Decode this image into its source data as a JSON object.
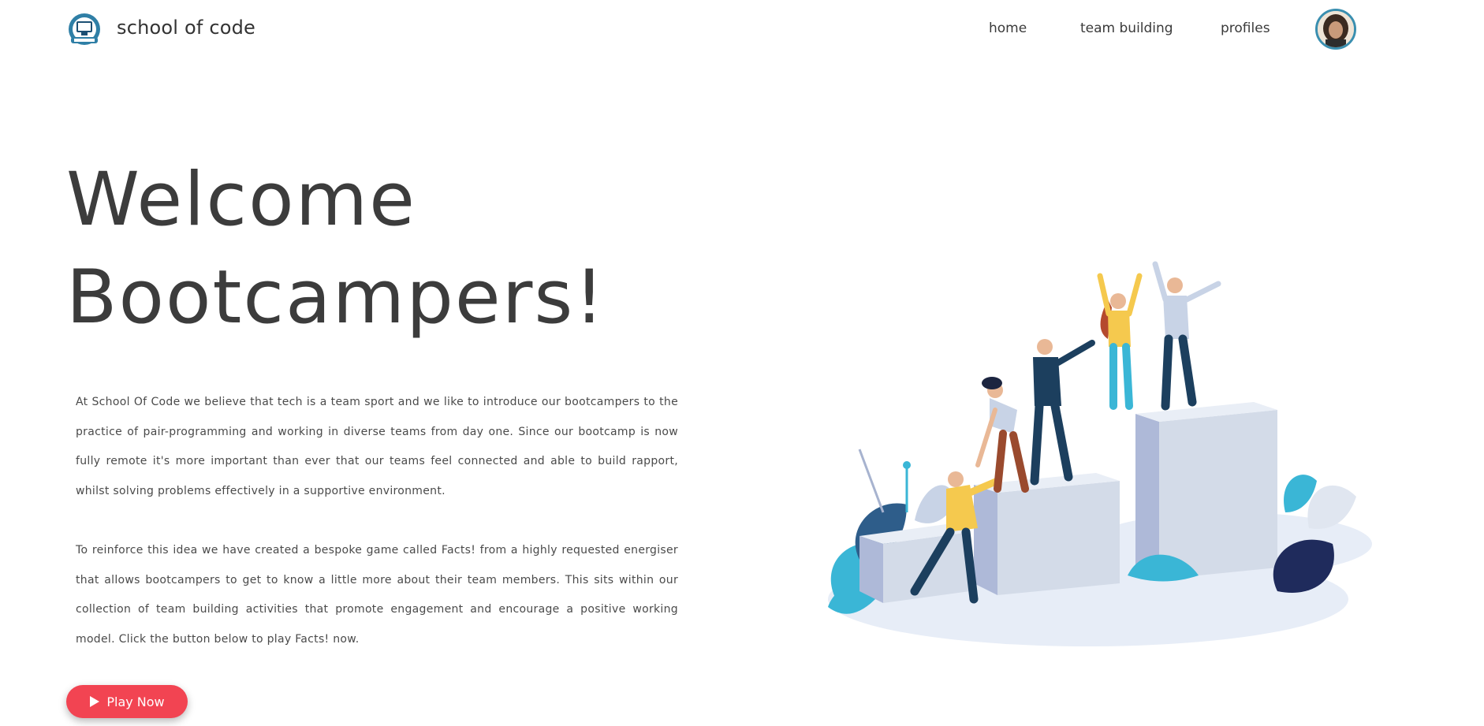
{
  "brand": {
    "name": "school of code"
  },
  "nav": {
    "home": "home",
    "team_building": "team building",
    "profiles": "profiles"
  },
  "hero": {
    "title_line1": "Welcome",
    "title_line2": "Bootcampers!",
    "paragraph1": "At School Of Code we believe that tech is a team sport and we like to introduce our bootcampers to the practice of pair-programming and working in diverse teams from day one. Since our bootcamp is now fully remote it's more important than ever that our teams feel connected and able to build rapport, whilst solving problems effectively in a supportive environment.",
    "paragraph2": "To reinforce this idea we have created a bespoke game called Facts! from a highly requested energiser that allows bootcampers to get to know a little more about their team members. This sits within our collection of team building activities that promote engagement and encourage a positive working model. Click the button below to play Facts! now.",
    "play_label": "Play Now"
  },
  "colors": {
    "accent": "#f24452",
    "navy": "#1c3f5e",
    "teal": "#3ab6d6",
    "yellow": "#f5c94e",
    "podium": "#d3dbe8"
  },
  "icons": [
    "school-of-code-logo-icon",
    "user-avatar",
    "play-icon",
    "teamwork-illustration"
  ]
}
